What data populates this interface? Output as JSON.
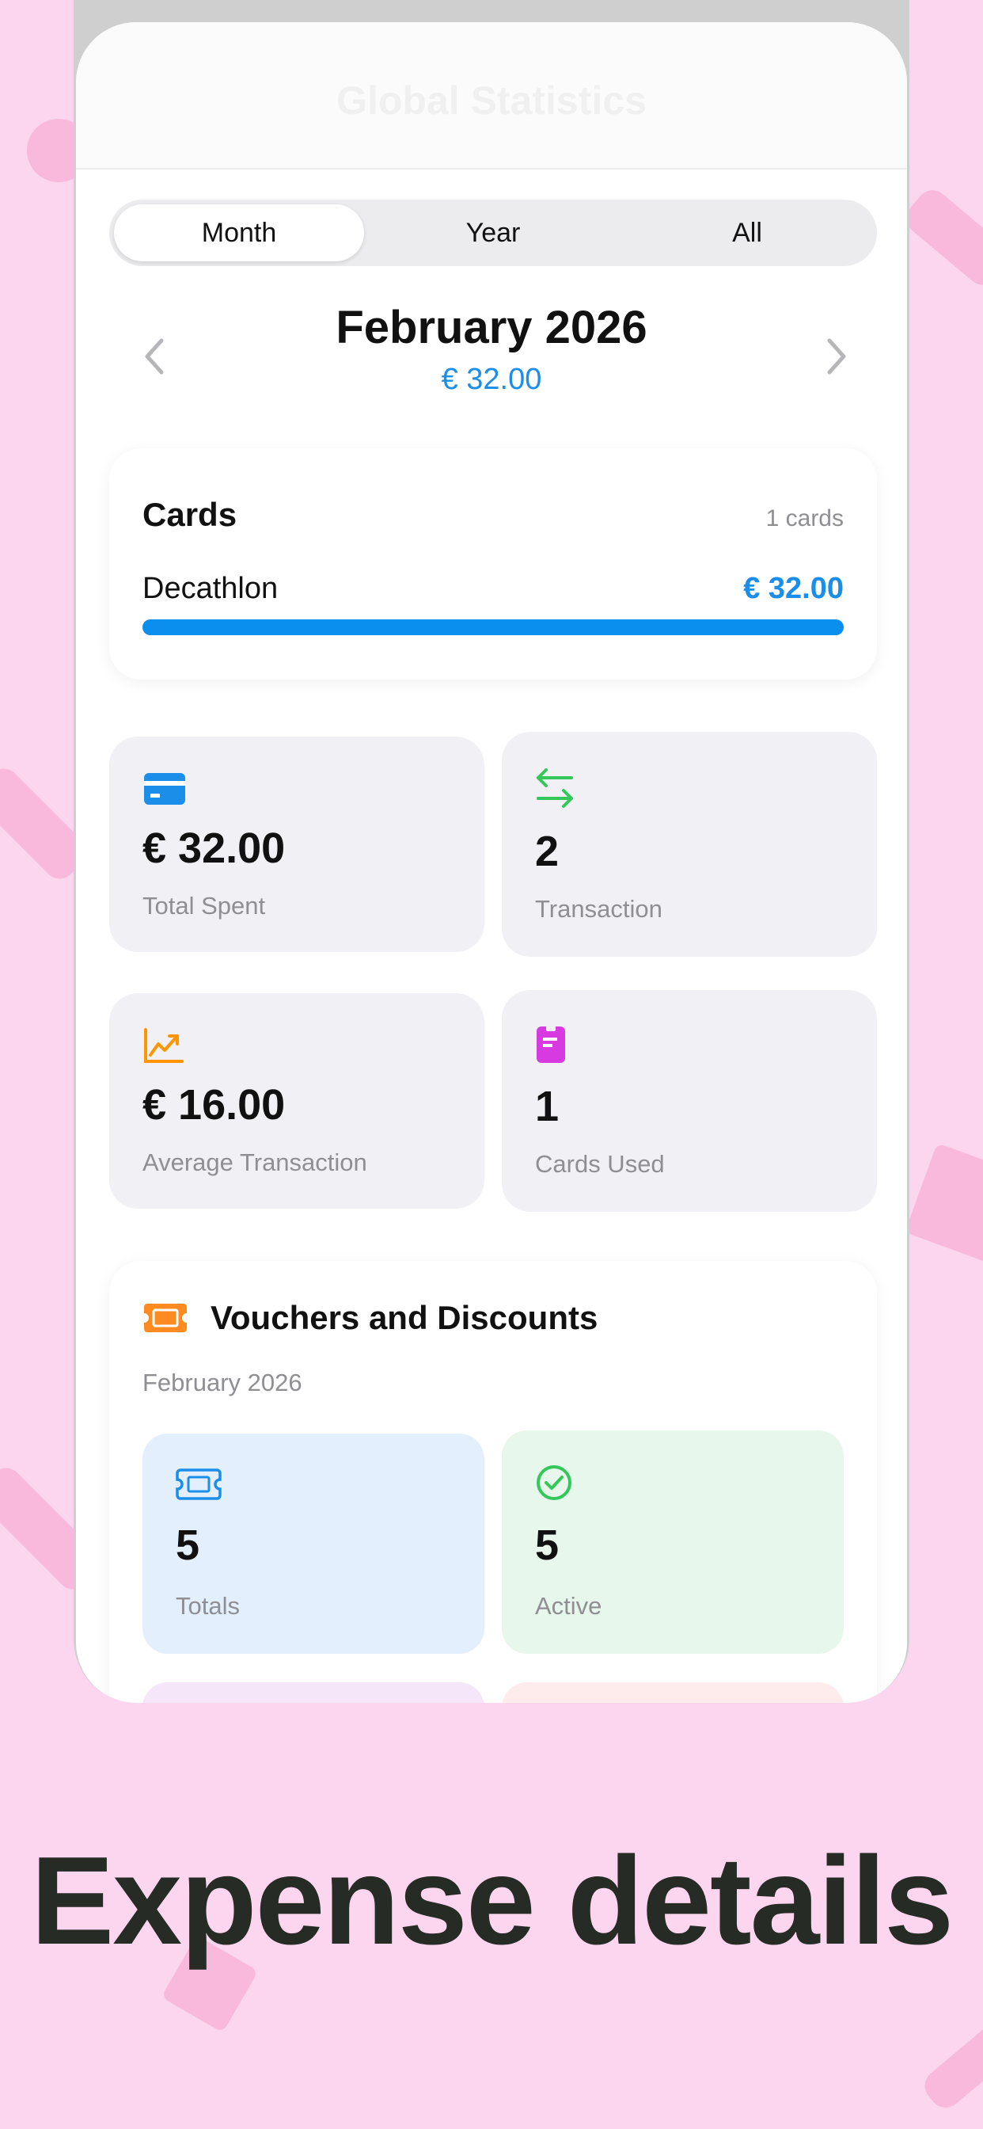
{
  "nav": {
    "title": "Global Statistics"
  },
  "segment": {
    "tabs": [
      "Month",
      "Year",
      "All"
    ],
    "selected": "Month"
  },
  "period": {
    "title": "February 2026",
    "amount": "€ 32.00"
  },
  "cards": {
    "title": "Cards",
    "count": "1 cards",
    "items": [
      {
        "name": "Decathlon",
        "amount": "€ 32.00",
        "share": 1.0
      }
    ]
  },
  "stats": [
    {
      "value": "€ 32.00",
      "label": "Total Spent",
      "icon": "credit-card-icon",
      "color": "#1a8ee8"
    },
    {
      "value": "2",
      "label": "Transaction",
      "icon": "arrows-exchange-icon",
      "color": "#34c759"
    },
    {
      "value": "€ 16.00",
      "label": "Average Transaction",
      "icon": "trending-up-chart-icon",
      "color": "#ff9500"
    },
    {
      "value": "1",
      "label": "Cards Used",
      "icon": "card-document-icon",
      "color": "#d63ae0"
    }
  ],
  "vouchers": {
    "title": "Vouchers and Discounts",
    "subtitle": "February 2026",
    "icon_color": "#ff8a1f",
    "items": [
      {
        "value": "5",
        "label": "Totals",
        "icon": "ticket-icon",
        "color": "#1a8ee8",
        "bg": "#e3effc"
      },
      {
        "value": "5",
        "label": "Active",
        "icon": "check-circle-icon",
        "color": "#34c759",
        "bg": "#e7f7ec"
      }
    ]
  },
  "caption": "Expense details"
}
